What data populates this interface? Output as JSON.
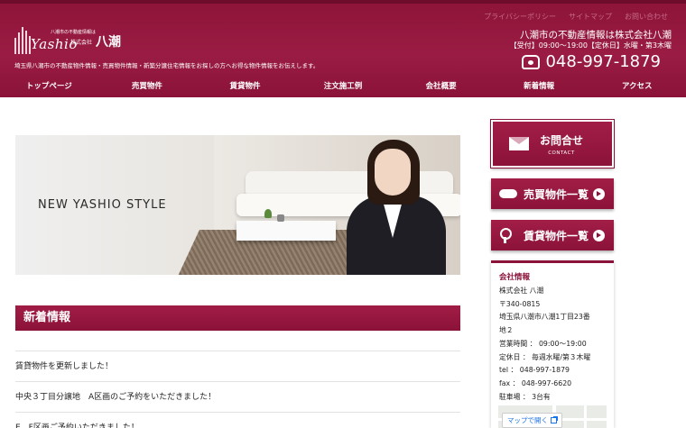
{
  "header": {
    "logo": {
      "script_text": "Yashio",
      "small_line1": "八潮市の不動産情報は",
      "small_line2": "株式会社",
      "name": "八潮"
    },
    "tagline": "埼玉県八潮市の不動産物件情報・売買物件情報・新築分譲住宅情報をお探しの方へお得な物件情報をお伝えします。",
    "util_links": [
      "プライバシーポリシー",
      "サイトマップ",
      "お問い合わせ"
    ],
    "company_line": "八潮市の不動産情報は株式会社八潮",
    "hours_line": "【受付】09:00～19:00【定休日】水曜・第3木曜",
    "phone": "048-997-1879"
  },
  "nav": [
    "トップページ",
    "売買物件",
    "賃貸物件",
    "注文施工例",
    "会社概要",
    "新着情報",
    "アクセス"
  ],
  "hero": {
    "text": "NEW YASHIO STYLE"
  },
  "news": {
    "heading": "新着情報",
    "items": [
      "賃貸物件を更新しました！",
      "中央３丁目分譲地　A区画のご予約をいただきました！",
      "E、F区画ご予約いただきました！"
    ]
  },
  "sidebar": {
    "contact": {
      "label": "お問合せ",
      "sub": "CONTACT"
    },
    "sale_button": "売買物件一覧",
    "rent_button": "賃貸物件一覧",
    "company": {
      "title": "会社情報",
      "lines": [
        "株式会社 八潮",
        "〒340-0815",
        "埼玉県八潮市八潮1丁目23番",
        "地２",
        "営業時間 ： 09:00～19:00",
        "定休日 ： 毎週水曜/第３木曜",
        "tel ： 048-997-1879",
        "fax ： 048-997-6620",
        "駐車場 ： 3台有"
      ],
      "map_link": "マップで開く"
    }
  },
  "colors": {
    "brand": "#8b1239",
    "accent": "#a21e47"
  }
}
